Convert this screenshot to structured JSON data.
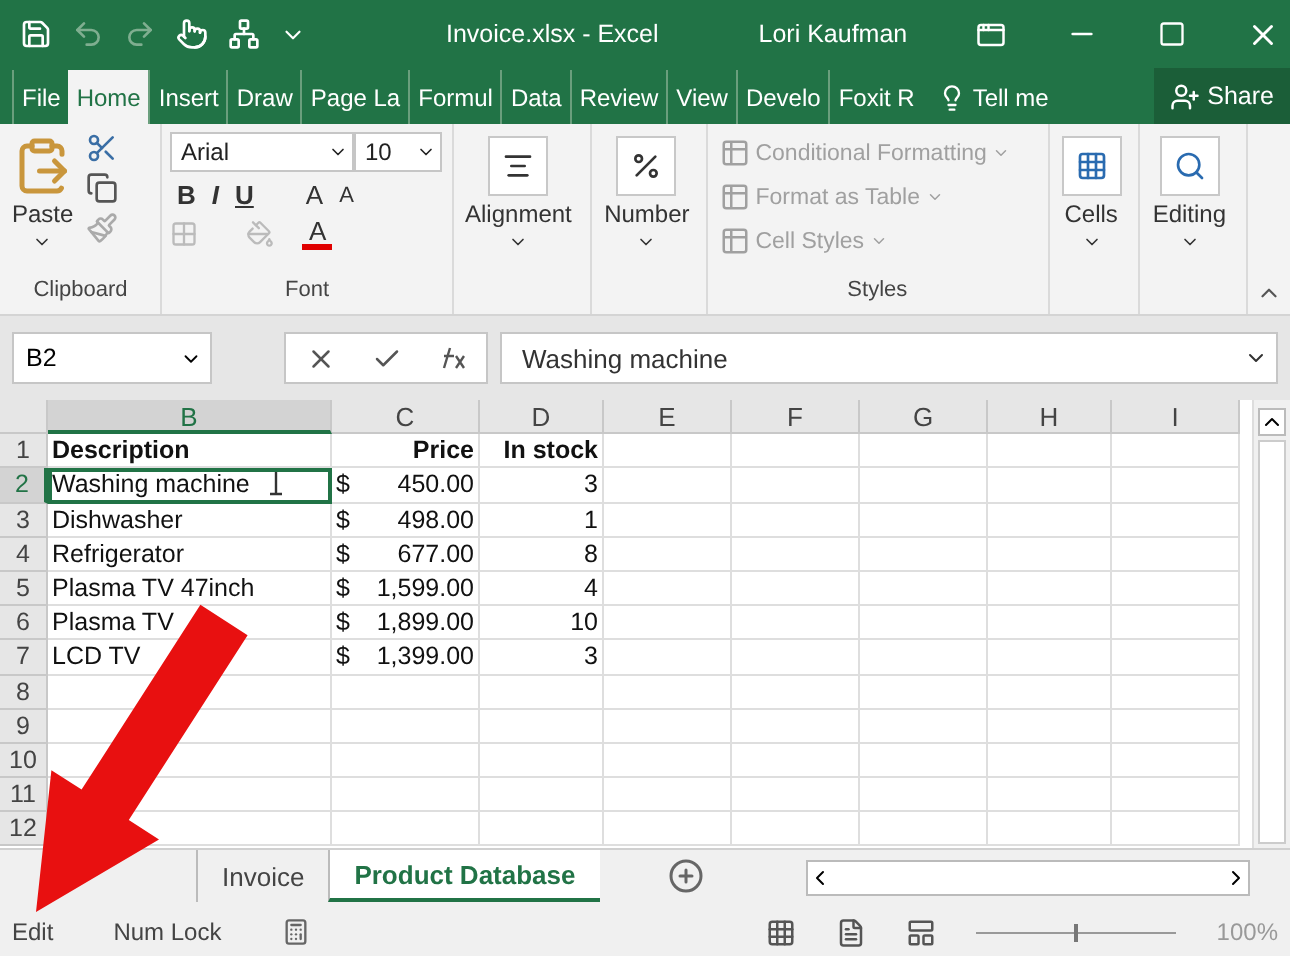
{
  "title_bar": {
    "title": "Invoice.xlsx - Excel",
    "user": "Lori Kaufman"
  },
  "ribbon_tabs": [
    {
      "label": "File",
      "selected": false
    },
    {
      "label": "Home",
      "selected": true
    },
    {
      "label": "Insert",
      "selected": false
    },
    {
      "label": "Draw",
      "selected": false
    },
    {
      "label": "Page La",
      "selected": false
    },
    {
      "label": "Formul",
      "selected": false
    },
    {
      "label": "Data",
      "selected": false
    },
    {
      "label": "Review",
      "selected": false
    },
    {
      "label": "View",
      "selected": false
    },
    {
      "label": "Develo",
      "selected": false
    },
    {
      "label": "Foxit R",
      "selected": false
    }
  ],
  "tell_me": "Tell me",
  "share": "Share",
  "ribbon": {
    "clipboard": {
      "paste": "Paste",
      "label": "Clipboard"
    },
    "font": {
      "name": "Arial",
      "size": "10",
      "bold": "B",
      "italic": "I",
      "underline": "U",
      "grow": "A",
      "shrink": "A",
      "font_color_button": "A",
      "label": "Font"
    },
    "alignment": "Alignment",
    "number": "Number",
    "styles": {
      "items": [
        {
          "label": "Conditional Formatting",
          "disabled": true
        },
        {
          "label": "Format as Table",
          "disabled": true
        },
        {
          "label": "Cell Styles",
          "disabled": true
        }
      ],
      "label": "Styles"
    },
    "cells": "Cells",
    "editing": "Editing"
  },
  "formula_bar": {
    "name_box": "B2",
    "value": "Washing machine"
  },
  "sheet": {
    "columns": [
      {
        "label": "B",
        "selected": true
      },
      {
        "label": "C",
        "selected": false
      },
      {
        "label": "D",
        "selected": false
      },
      {
        "label": "E",
        "selected": false
      },
      {
        "label": "F",
        "selected": false
      },
      {
        "label": "G",
        "selected": false
      },
      {
        "label": "H",
        "selected": false
      },
      {
        "label": "I",
        "selected": false
      }
    ],
    "rows": [
      {
        "number": "1",
        "selected": false,
        "kind": "header",
        "description": "Description",
        "price": "Price",
        "stock": "In stock"
      },
      {
        "number": "2",
        "selected": true,
        "kind": "item",
        "description": "Washing machine",
        "currency": "$",
        "amount": "450.00",
        "stock": "3"
      },
      {
        "number": "3",
        "selected": false,
        "kind": "item",
        "description": "Dishwasher",
        "currency": "$",
        "amount": "498.00",
        "stock": "1"
      },
      {
        "number": "4",
        "selected": false,
        "kind": "item",
        "description": "Refrigerator",
        "currency": "$",
        "amount": "677.00",
        "stock": "8"
      },
      {
        "number": "5",
        "selected": false,
        "kind": "item",
        "description": "Plasma TV 47inch",
        "currency": "$",
        "amount": "1,599.00",
        "stock": "4"
      },
      {
        "number": "6",
        "selected": false,
        "kind": "item",
        "description": "Plasma TV",
        "currency": "$",
        "amount": "1,899.00",
        "stock": "10"
      },
      {
        "number": "7",
        "selected": false,
        "kind": "item",
        "description": "LCD TV",
        "currency": "$",
        "amount": "1,399.00",
        "stock": "3"
      },
      {
        "number": "8",
        "selected": false,
        "kind": "empty"
      },
      {
        "number": "9",
        "selected": false,
        "kind": "empty"
      },
      {
        "number": "10",
        "selected": false,
        "kind": "empty"
      },
      {
        "number": "11",
        "selected": false,
        "kind": "empty"
      },
      {
        "number": "12",
        "selected": false,
        "kind": "empty"
      }
    ]
  },
  "sheet_tabs": [
    {
      "label": "Invoice",
      "selected": false
    },
    {
      "label": "Product Database",
      "selected": true
    }
  ],
  "status_bar": {
    "mode": "Edit",
    "num_lock": "Num Lock",
    "zoom_slider": {
      "level": 0.5
    },
    "zoom": "100%"
  }
}
